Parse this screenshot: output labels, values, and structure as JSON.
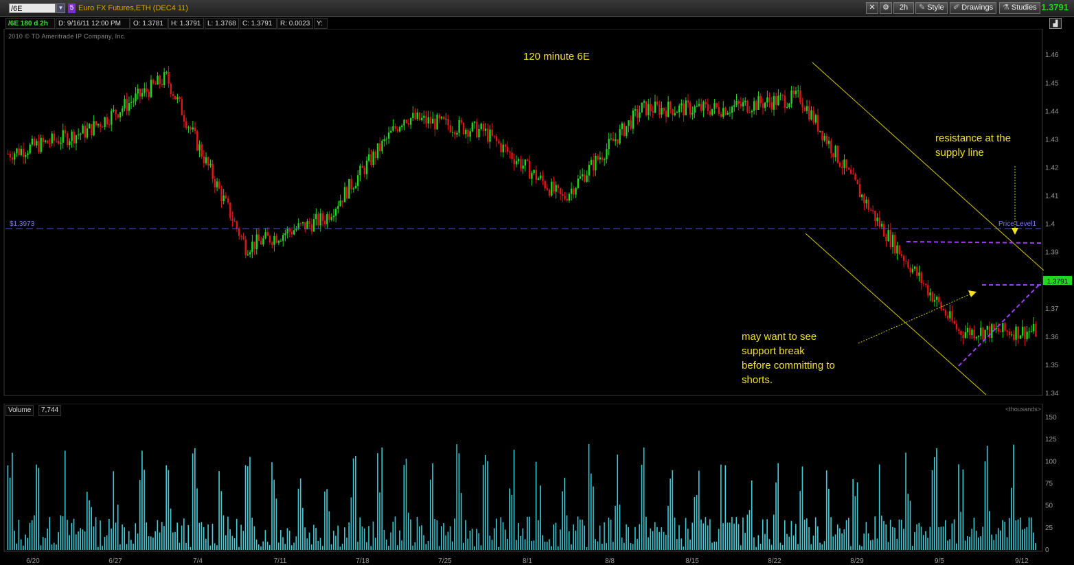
{
  "toolbar": {
    "symbol": "/6E",
    "link_badge": "5",
    "description": "Euro FX Futures,ETH (DEC4 11)",
    "aggregation": "2h",
    "style_label": "Style",
    "drawings_label": "Drawings",
    "studies_label": "Studies",
    "last_price": "1.3791"
  },
  "info": {
    "study": "/6E 180 d 2h",
    "date": "D: 9/16/11 12:00 PM",
    "open": "O: 1.3781",
    "high": "H: 1.3791",
    "low": "L: 1.3768",
    "close": "C: 1.3791",
    "range": "R: 0.0023",
    "y": "Y:"
  },
  "copyright": "2010 © TD Ameritrade IP Company, Inc.",
  "chart_title": "120 minute 6E",
  "price_level_value": "$1.3973",
  "price_level_label": "Price Level1",
  "current_price_tag": "1.3791",
  "annotations": {
    "resistance": [
      "resistance at the",
      "supply line"
    ],
    "support": [
      "may want to see",
      "support break",
      "before committing to",
      "shorts."
    ]
  },
  "volume": {
    "label": "Volume",
    "value": "7,744",
    "unit_label": "<thousands>"
  },
  "colors": {
    "up": "#1fd81f",
    "down": "#e01515",
    "volume": "#3fd0dc",
    "trendline": "#d8c800",
    "support_dash": "#a23cff",
    "price_level": "#5050e0"
  },
  "chart_data": [
    {
      "type": "candlestick",
      "title": "120 minute 6E",
      "y_axis_ticks": [
        "1.46",
        "1.45",
        "1.44",
        "1.43",
        "1.42",
        "1.41",
        "1.4",
        "1.39",
        "1.38",
        "1.37",
        "1.36",
        "1.35",
        "1.34"
      ],
      "ylim": [
        1.34,
        1.462
      ],
      "x_tick_labels": [
        "6/20",
        "6/27",
        "7/4",
        "7/11",
        "7/18",
        "7/25",
        "8/1",
        "8/8",
        "8/15",
        "8/22",
        "8/29",
        "9/5",
        "9/12"
      ],
      "approx_closes_by_week": [
        {
          "week": "6/20",
          "close": 1.425
        },
        {
          "week": "6/27",
          "close": 1.433
        },
        {
          "week": "7/4",
          "close": 1.452
        },
        {
          "week": "7/11",
          "close": 1.392
        },
        {
          "week": "7/18",
          "close": 1.402
        },
        {
          "week": "7/25",
          "close": 1.438
        },
        {
          "week": "8/1",
          "close": 1.433
        },
        {
          "week": "8/8",
          "close": 1.409
        },
        {
          "week": "8/15",
          "close": 1.441
        },
        {
          "week": "8/22",
          "close": 1.441
        },
        {
          "week": "8/29",
          "close": 1.445
        },
        {
          "week": "9/5",
          "close": 1.4
        },
        {
          "week": "9/12",
          "close": 1.362
        }
      ],
      "last": {
        "date": "9/16/11 12:00 PM",
        "open": 1.3781,
        "high": 1.3791,
        "low": 1.3768,
        "close": 1.3791
      }
    },
    {
      "type": "bar",
      "title": "Volume",
      "unit": "thousands",
      "y_axis_ticks": [
        "150",
        "125",
        "100",
        "75",
        "50",
        "25",
        "0"
      ],
      "ylim": [
        0,
        150
      ],
      "last_value": 7744
    }
  ]
}
